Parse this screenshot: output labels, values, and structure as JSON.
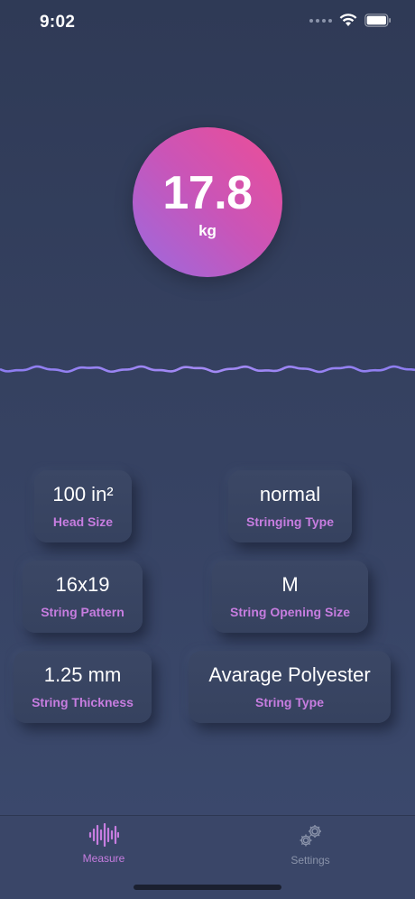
{
  "status_bar": {
    "time": "9:02"
  },
  "measurement": {
    "value": "17.8",
    "unit": "kg"
  },
  "settings_cards": [
    {
      "value": "100 in²",
      "label": "Head Size"
    },
    {
      "value": "normal",
      "label": "Stringing Type"
    },
    {
      "value": "16x19",
      "label": "String Pattern"
    },
    {
      "value": "M",
      "label": "String Opening Size"
    },
    {
      "value": "1.25 mm",
      "label": "String Thickness"
    },
    {
      "value": "Avarage Polyester",
      "label": "String Type"
    }
  ],
  "tab_bar": {
    "tabs": [
      {
        "label": "Measure",
        "icon": "waveform-icon",
        "active": true
      },
      {
        "label": "Settings",
        "icon": "gears-icon",
        "active": false
      }
    ]
  },
  "colors": {
    "accent": "#c77de0",
    "circle_start": "#ee4d95",
    "circle_end": "#9a6ae0",
    "inactive": "#8a93aa"
  }
}
